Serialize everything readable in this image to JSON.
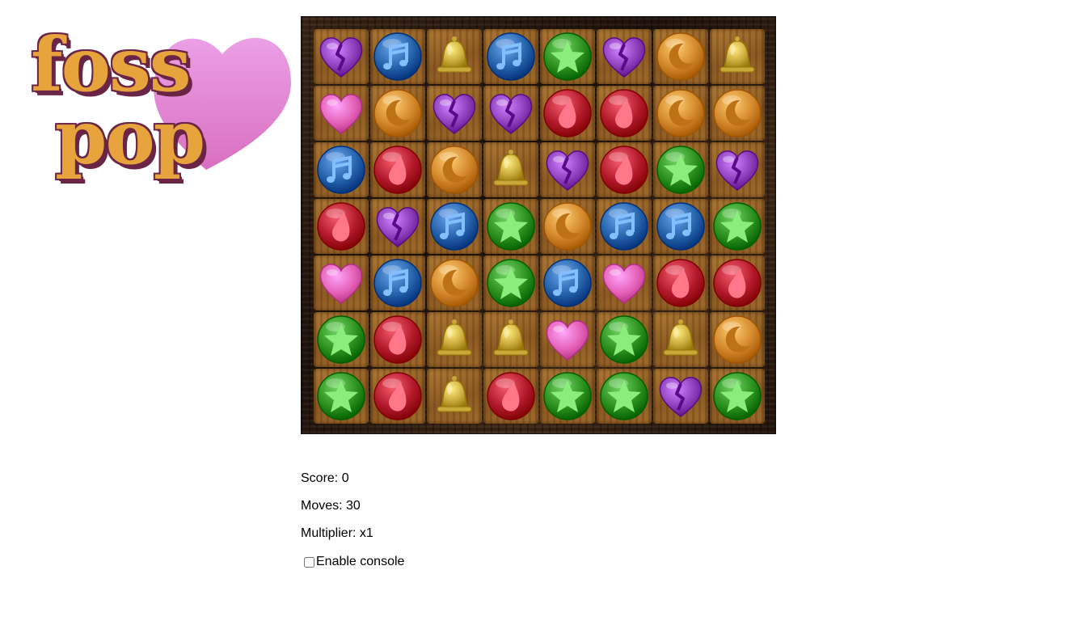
{
  "logo": {
    "line1": "foss",
    "line2": "pop"
  },
  "board": {
    "rows": [
      [
        "broken-heart",
        "music",
        "bell",
        "music",
        "star",
        "broken-heart",
        "moon",
        "bell"
      ],
      [
        "heart",
        "moon",
        "broken-heart",
        "broken-heart",
        "drop",
        "drop",
        "moon",
        "moon"
      ],
      [
        "music",
        "drop",
        "moon",
        "bell",
        "broken-heart",
        "drop",
        "star",
        "broken-heart"
      ],
      [
        "drop",
        "broken-heart",
        "music",
        "star",
        "moon",
        "music",
        "music",
        "star"
      ],
      [
        "heart",
        "music",
        "moon",
        "star",
        "music",
        "heart",
        "drop",
        "drop"
      ],
      [
        "star",
        "drop",
        "bell",
        "bell",
        "heart",
        "star",
        "bell",
        "moon"
      ],
      [
        "star",
        "drop",
        "bell",
        "drop",
        "star",
        "star",
        "broken-heart",
        "star"
      ]
    ]
  },
  "colors": {
    "heart": "#e35fb5",
    "broken-heart": "#8a3db8",
    "music": "#2460a8",
    "bell": "#c9a83a",
    "star": "#2b8f1d",
    "drop": "#b0182a",
    "moon": "#d2862a",
    "logo_heart": "#e68fd8"
  },
  "stats": {
    "score": "Score: 0",
    "moves": "Moves: 30",
    "multiplier": "Multiplier: x1"
  },
  "console": {
    "label": "Enable console",
    "checked": false
  }
}
